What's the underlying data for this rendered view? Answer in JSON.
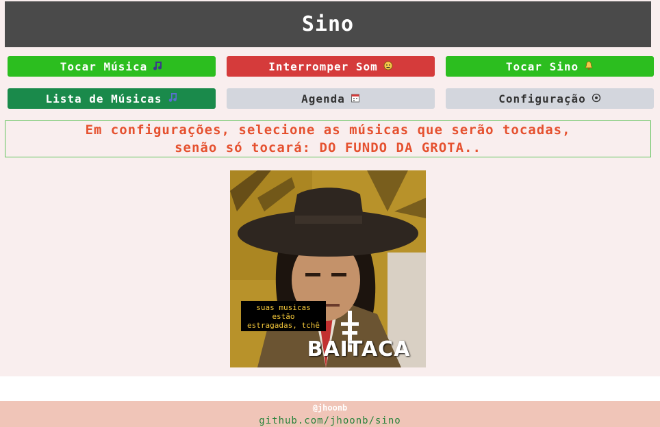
{
  "header": {
    "title": "Sino"
  },
  "buttons": {
    "play_music": {
      "label": "Tocar Música",
      "icon": "music-notes-icon"
    },
    "stop_sound": {
      "label": "Interromper Som",
      "icon": "frown-face-icon"
    },
    "play_bell": {
      "label": "Tocar Sino",
      "icon": "bell-icon"
    },
    "music_list": {
      "label": "Lista de Músicas",
      "icon": "music-note-icon"
    },
    "schedule": {
      "label": "Agenda",
      "icon": "calendar-icon"
    },
    "settings": {
      "label": "Configuração",
      "icon": "gear-icon"
    }
  },
  "notice": {
    "line1": "Em configurações, selecione as músicas que serão tocadas,",
    "line2": "senão só tocará: DO FUNDO DA GROTA.."
  },
  "image": {
    "caption_line1": "suas musicas",
    "caption_line2": "estão",
    "caption_line3": "estragadas, tchê",
    "logo_text": "BAITACA"
  },
  "footer": {
    "handle": "@jhoonb",
    "link": "github.com/jhoonb/sino"
  },
  "colors": {
    "header_bg": "#4a4a4a",
    "green": "#2cbe1f",
    "red": "#d53b3b",
    "dark_green": "#1a8a4b",
    "gray": "#d3d6dd",
    "notice_text": "#e5512f",
    "footer_bg": "#f0c5b8"
  }
}
